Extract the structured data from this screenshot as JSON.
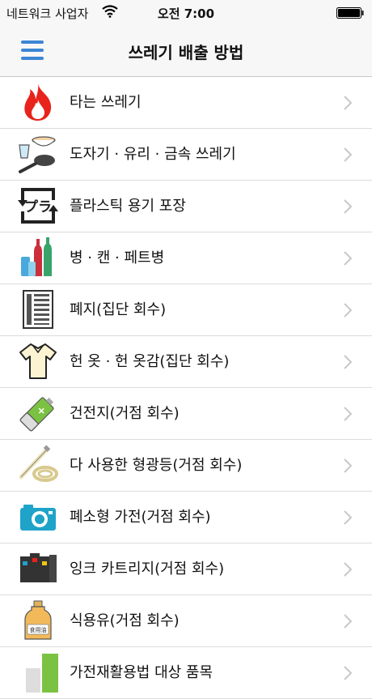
{
  "status_bar": {
    "carrier": "네트워크 사업자",
    "time": "오전 7:00"
  },
  "header": {
    "title": "쓰레기 배출 방법"
  },
  "list": {
    "items": [
      {
        "label": "타는 쓰레기",
        "icon": "flame-icon"
      },
      {
        "label": "도자기 · 유리 · 금속 쓰레기",
        "icon": "dishes-pan-icon"
      },
      {
        "label": "플라스틱 용기 포장",
        "icon": "plastic-recycle-icon"
      },
      {
        "label": "병 · 캔 · 페트병",
        "icon": "bottles-icon"
      },
      {
        "label": "폐지(집단 회수)",
        "icon": "newspaper-icon"
      },
      {
        "label": "헌 옷 · 헌 옷감(집단 회수)",
        "icon": "shirt-icon"
      },
      {
        "label": "건전지(거점 회수)",
        "icon": "battery-icon"
      },
      {
        "label": "다 사용한 형광등(거점 회수)",
        "icon": "fluorescent-lamp-icon"
      },
      {
        "label": "폐소형 가전(거점 회수)",
        "icon": "camera-icon"
      },
      {
        "label": "잉크 카트리지(거점 회수)",
        "icon": "ink-cartridge-icon"
      },
      {
        "label": "식용유(거점 회수)",
        "icon": "oil-bottle-icon",
        "icon_text": "食用油"
      },
      {
        "label": "가전재활용법 대상 품목",
        "icon": "appliance-icon"
      }
    ]
  },
  "colors": {
    "accent": "#3b86d6",
    "flame": "#e8231b"
  }
}
